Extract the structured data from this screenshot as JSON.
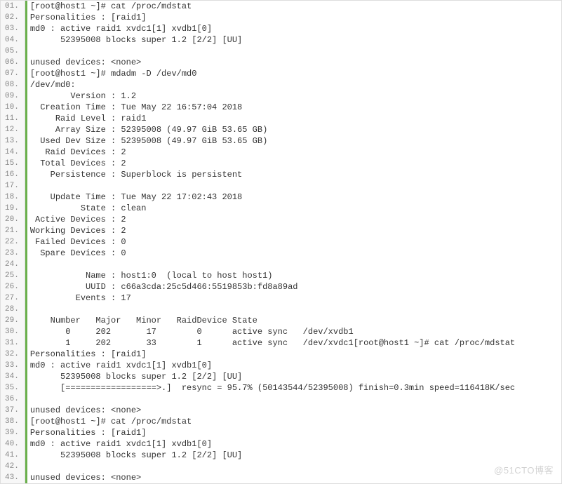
{
  "watermark": "@51CTO博客",
  "lines": [
    {
      "n": "01.",
      "t": "[root@host1 ~]# cat /proc/mdstat"
    },
    {
      "n": "02.",
      "t": "Personalities : [raid1]"
    },
    {
      "n": "03.",
      "t": "md0 : active raid1 xvdc1[1] xvdb1[0]"
    },
    {
      "n": "04.",
      "t": "      52395008 blocks super 1.2 [2/2] [UU]"
    },
    {
      "n": "05.",
      "t": ""
    },
    {
      "n": "06.",
      "t": "unused devices: <none>"
    },
    {
      "n": "07.",
      "t": "[root@host1 ~]# mdadm -D /dev/md0"
    },
    {
      "n": "08.",
      "t": "/dev/md0:"
    },
    {
      "n": "09.",
      "t": "        Version : 1.2"
    },
    {
      "n": "10.",
      "t": "  Creation Time : Tue May 22 16:57:04 2018"
    },
    {
      "n": "11.",
      "t": "     Raid Level : raid1"
    },
    {
      "n": "12.",
      "t": "     Array Size : 52395008 (49.97 GiB 53.65 GB)"
    },
    {
      "n": "13.",
      "t": "  Used Dev Size : 52395008 (49.97 GiB 53.65 GB)"
    },
    {
      "n": "14.",
      "t": "   Raid Devices : 2"
    },
    {
      "n": "15.",
      "t": "  Total Devices : 2"
    },
    {
      "n": "16.",
      "t": "    Persistence : Superblock is persistent"
    },
    {
      "n": "17.",
      "t": ""
    },
    {
      "n": "18.",
      "t": "    Update Time : Tue May 22 17:02:43 2018"
    },
    {
      "n": "19.",
      "t": "          State : clean"
    },
    {
      "n": "20.",
      "t": " Active Devices : 2"
    },
    {
      "n": "21.",
      "t": "Working Devices : 2"
    },
    {
      "n": "22.",
      "t": " Failed Devices : 0"
    },
    {
      "n": "23.",
      "t": "  Spare Devices : 0"
    },
    {
      "n": "24.",
      "t": ""
    },
    {
      "n": "25.",
      "t": "           Name : host1:0  (local to host host1)"
    },
    {
      "n": "26.",
      "t": "           UUID : c66a3cda:25c5d466:5519853b:fd8a89ad"
    },
    {
      "n": "27.",
      "t": "         Events : 17"
    },
    {
      "n": "28.",
      "t": ""
    },
    {
      "n": "29.",
      "t": "    Number   Major   Minor   RaidDevice State"
    },
    {
      "n": "30.",
      "t": "       0     202       17        0      active sync   /dev/xvdb1"
    },
    {
      "n": "31.",
      "t": "       1     202       33        1      active sync   /dev/xvdc1[root@host1 ~]# cat /proc/mdstat"
    },
    {
      "n": "32.",
      "t": "Personalities : [raid1]"
    },
    {
      "n": "33.",
      "t": "md0 : active raid1 xvdc1[1] xvdb1[0]"
    },
    {
      "n": "34.",
      "t": "      52395008 blocks super 1.2 [2/2] [UU]"
    },
    {
      "n": "35.",
      "t": "      [==================>.]  resync = 95.7% (50143544/52395008) finish=0.3min speed=116418K/sec"
    },
    {
      "n": "36.",
      "t": ""
    },
    {
      "n": "37.",
      "t": "unused devices: <none>"
    },
    {
      "n": "38.",
      "t": "[root@host1 ~]# cat /proc/mdstat"
    },
    {
      "n": "39.",
      "t": "Personalities : [raid1]"
    },
    {
      "n": "40.",
      "t": "md0 : active raid1 xvdc1[1] xvdb1[0]"
    },
    {
      "n": "41.",
      "t": "      52395008 blocks super 1.2 [2/2] [UU]"
    },
    {
      "n": "42.",
      "t": ""
    },
    {
      "n": "43.",
      "t": "unused devices: <none>"
    }
  ]
}
